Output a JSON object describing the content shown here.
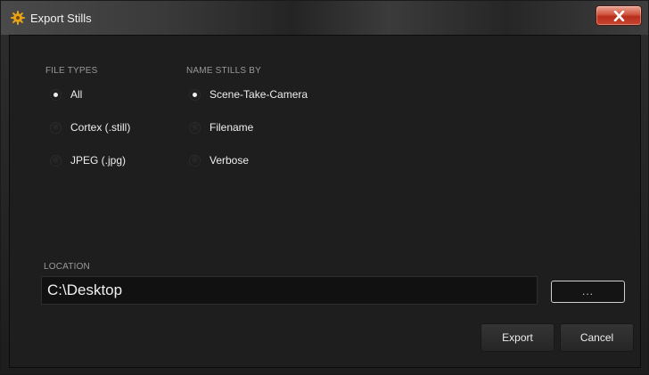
{
  "window": {
    "title": "Export Stills",
    "icon": "app-gear-icon",
    "close_icon": "close-icon"
  },
  "file_types": {
    "label": "FILE TYPES",
    "options": [
      {
        "label": "All",
        "checked": true
      },
      {
        "label": "Cortex (.still)",
        "checked": false
      },
      {
        "label": "JPEG (.jpg)",
        "checked": false
      }
    ]
  },
  "name_stills_by": {
    "label": "NAME STILLS BY",
    "options": [
      {
        "label": "Scene-Take-Camera",
        "checked": true
      },
      {
        "label": "Filename",
        "checked": false
      },
      {
        "label": "Verbose",
        "checked": false
      }
    ]
  },
  "location": {
    "label": "LOCATION",
    "value": "C:\\Desktop",
    "browse_label": "..."
  },
  "buttons": {
    "export": "Export",
    "cancel": "Cancel"
  },
  "colors": {
    "background": "#1e1e1e",
    "close_button": "#c9452f",
    "app_icon": "#e8a317"
  }
}
